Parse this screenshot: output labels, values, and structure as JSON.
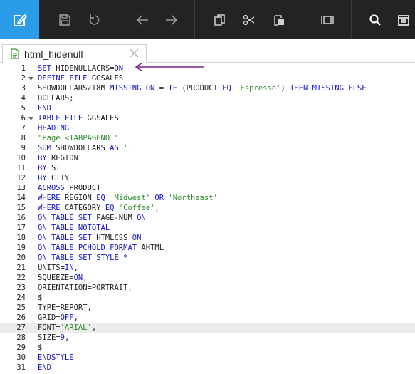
{
  "toolbar": {
    "buttons": [
      {
        "name": "edit",
        "icon": "edit-icon",
        "active": true
      },
      {
        "name": "save",
        "icon": "save-icon"
      },
      {
        "name": "refresh",
        "icon": "refresh-icon"
      },
      {
        "name": "back",
        "icon": "back-arrow-icon"
      },
      {
        "name": "forward",
        "icon": "forward-arrow-icon"
      },
      {
        "name": "copy",
        "icon": "copy-icon"
      },
      {
        "name": "cut",
        "icon": "scissors-icon"
      },
      {
        "name": "paste",
        "icon": "paste-icon"
      },
      {
        "name": "split",
        "icon": "split-view-icon"
      },
      {
        "name": "search",
        "icon": "search-icon"
      },
      {
        "name": "preview",
        "icon": "preview-icon"
      }
    ],
    "accent": "#2a9ce8",
    "background": "#222325"
  },
  "tab": {
    "label": "html_hidenull",
    "icon": "file-icon",
    "close_icon": "close-icon"
  },
  "editor": {
    "active_line": 27,
    "colors": {
      "keyword": "#1414c8",
      "string": "#2d8a2d",
      "text": "#222222",
      "annotation_arrow": "#7a1e8c"
    },
    "lines": [
      {
        "n": "1",
        "fold": false,
        "tokens": [
          {
            "t": "SET ",
            "c": "kw"
          },
          {
            "t": "HIDENULLACRS=",
            "c": "tx"
          },
          {
            "t": "ON",
            "c": "kw"
          }
        ]
      },
      {
        "n": "2",
        "fold": true,
        "tokens": [
          {
            "t": "DEFINE FILE ",
            "c": "kw"
          },
          {
            "t": "GGSALES",
            "c": "tx"
          }
        ]
      },
      {
        "n": "3",
        "fold": false,
        "tokens": [
          {
            "t": "SHOWDOLLARS/I8M ",
            "c": "tx"
          },
          {
            "t": "MISSING ON",
            "c": "kw"
          },
          {
            "t": " = ",
            "c": "tx"
          },
          {
            "t": "IF",
            "c": "kw"
          },
          {
            "t": " (PRODUCT ",
            "c": "tx"
          },
          {
            "t": "EQ",
            "c": "kw"
          },
          {
            "t": " ",
            "c": "tx"
          },
          {
            "t": "'Espresso'",
            "c": "str"
          },
          {
            "t": ") ",
            "c": "tx"
          },
          {
            "t": "THEN MISSING ELSE",
            "c": "kw"
          }
        ]
      },
      {
        "n": "4",
        "fold": false,
        "tokens": [
          {
            "t": "DOLLARS;",
            "c": "tx"
          }
        ]
      },
      {
        "n": "5",
        "fold": false,
        "tokens": [
          {
            "t": "END",
            "c": "kw"
          }
        ]
      },
      {
        "n": "6",
        "fold": true,
        "tokens": [
          {
            "t": "TABLE FILE ",
            "c": "kw"
          },
          {
            "t": "GGSALES",
            "c": "tx"
          }
        ]
      },
      {
        "n": "7",
        "fold": false,
        "tokens": [
          {
            "t": "HEADING",
            "c": "kw"
          }
        ]
      },
      {
        "n": "8",
        "fold": false,
        "tokens": [
          {
            "t": "\"Page <TABPAGENO \"",
            "c": "str"
          }
        ]
      },
      {
        "n": "9",
        "fold": false,
        "tokens": [
          {
            "t": "SUM ",
            "c": "kw"
          },
          {
            "t": "SHOWDOLLARS ",
            "c": "tx"
          },
          {
            "t": "AS",
            "c": "kw"
          },
          {
            "t": " ",
            "c": "tx"
          },
          {
            "t": "''",
            "c": "str"
          }
        ]
      },
      {
        "n": "10",
        "fold": false,
        "tokens": [
          {
            "t": "BY ",
            "c": "kw"
          },
          {
            "t": "REGION",
            "c": "tx"
          }
        ]
      },
      {
        "n": "11",
        "fold": false,
        "tokens": [
          {
            "t": "BY ",
            "c": "kw"
          },
          {
            "t": "ST",
            "c": "tx"
          }
        ]
      },
      {
        "n": "12",
        "fold": false,
        "tokens": [
          {
            "t": "BY ",
            "c": "kw"
          },
          {
            "t": "CITY",
            "c": "tx"
          }
        ]
      },
      {
        "n": "13",
        "fold": false,
        "tokens": [
          {
            "t": "ACROSS ",
            "c": "kw"
          },
          {
            "t": "PRODUCT",
            "c": "tx"
          }
        ]
      },
      {
        "n": "14",
        "fold": false,
        "tokens": [
          {
            "t": "WHERE ",
            "c": "kw"
          },
          {
            "t": "REGION ",
            "c": "tx"
          },
          {
            "t": "EQ",
            "c": "kw"
          },
          {
            "t": " ",
            "c": "tx"
          },
          {
            "t": "'Midwest'",
            "c": "str"
          },
          {
            "t": " ",
            "c": "tx"
          },
          {
            "t": "OR",
            "c": "kw"
          },
          {
            "t": " ",
            "c": "tx"
          },
          {
            "t": "'Northeast'",
            "c": "str"
          }
        ]
      },
      {
        "n": "15",
        "fold": false,
        "tokens": [
          {
            "t": "WHERE ",
            "c": "kw"
          },
          {
            "t": "CATEGORY ",
            "c": "tx"
          },
          {
            "t": "EQ",
            "c": "kw"
          },
          {
            "t": " ",
            "c": "tx"
          },
          {
            "t": "'Coffee'",
            "c": "str"
          },
          {
            "t": ";",
            "c": "tx"
          }
        ]
      },
      {
        "n": "16",
        "fold": false,
        "tokens": [
          {
            "t": "ON TABLE SET ",
            "c": "kw"
          },
          {
            "t": "PAGE-NUM ",
            "c": "tx"
          },
          {
            "t": "ON",
            "c": "kw"
          }
        ]
      },
      {
        "n": "17",
        "fold": false,
        "tokens": [
          {
            "t": "ON TABLE ",
            "c": "kw"
          },
          {
            "t": "NOTOTAL",
            "c": "kw"
          }
        ]
      },
      {
        "n": "18",
        "fold": false,
        "tokens": [
          {
            "t": "ON TABLE SET ",
            "c": "kw"
          },
          {
            "t": "HTMLCSS ",
            "c": "tx"
          },
          {
            "t": "ON",
            "c": "kw"
          }
        ]
      },
      {
        "n": "19",
        "fold": false,
        "tokens": [
          {
            "t": "ON TABLE ",
            "c": "kw"
          },
          {
            "t": "PCHOLD FORMAT ",
            "c": "kw"
          },
          {
            "t": "AHTML",
            "c": "tx"
          }
        ]
      },
      {
        "n": "20",
        "fold": false,
        "tokens": [
          {
            "t": "ON TABLE SET ",
            "c": "kw"
          },
          {
            "t": "STYLE *",
            "c": "kw"
          }
        ]
      },
      {
        "n": "21",
        "fold": false,
        "tokens": [
          {
            "t": "UNITS=",
            "c": "tx"
          },
          {
            "t": "IN",
            "c": "kw"
          },
          {
            "t": ",",
            "c": "tx"
          }
        ]
      },
      {
        "n": "22",
        "fold": false,
        "tokens": [
          {
            "t": "SQUEEZE=",
            "c": "tx"
          },
          {
            "t": "ON",
            "c": "kw"
          },
          {
            "t": ",",
            "c": "tx"
          }
        ]
      },
      {
        "n": "23",
        "fold": false,
        "tokens": [
          {
            "t": "ORIENTATION=PORTRAIT,",
            "c": "tx"
          }
        ]
      },
      {
        "n": "24",
        "fold": false,
        "tokens": [
          {
            "t": "$",
            "c": "tx"
          }
        ]
      },
      {
        "n": "25",
        "fold": false,
        "tokens": [
          {
            "t": "TYPE=REPORT,",
            "c": "tx"
          }
        ]
      },
      {
        "n": "26",
        "fold": false,
        "tokens": [
          {
            "t": "GRID=",
            "c": "tx"
          },
          {
            "t": "OFF",
            "c": "kw"
          },
          {
            "t": ",",
            "c": "tx"
          }
        ]
      },
      {
        "n": "27",
        "fold": false,
        "tokens": [
          {
            "t": "FONT=",
            "c": "tx"
          },
          {
            "t": "'ARIAL'",
            "c": "str"
          },
          {
            "t": ",",
            "c": "tx"
          }
        ]
      },
      {
        "n": "28",
        "fold": false,
        "tokens": [
          {
            "t": "SIZE=",
            "c": "tx"
          },
          {
            "t": "9",
            "c": "kw"
          },
          {
            "t": ",",
            "c": "tx"
          }
        ]
      },
      {
        "n": "29",
        "fold": false,
        "tokens": [
          {
            "t": "$",
            "c": "tx"
          }
        ]
      },
      {
        "n": "30",
        "fold": false,
        "tokens": [
          {
            "t": "ENDSTYLE",
            "c": "kw"
          }
        ]
      },
      {
        "n": "31",
        "fold": false,
        "tokens": [
          {
            "t": "END",
            "c": "kw"
          }
        ]
      }
    ]
  }
}
